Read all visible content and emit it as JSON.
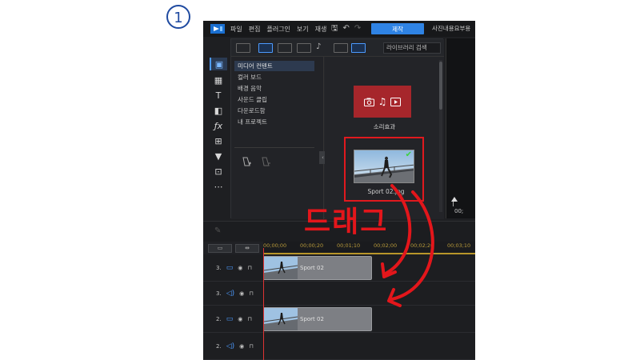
{
  "step_badge": {
    "number": "1"
  },
  "menubar": {
    "items": [
      "파일",
      "편집",
      "플러그인",
      "보기",
      "재생"
    ],
    "produce_label": "제작",
    "right_text": "사진내용요부용",
    "icons": [
      "save-icon",
      "undo-icon",
      "redo-icon"
    ]
  },
  "rail": {
    "items": [
      {
        "icon": "media-room-icon",
        "glyph": "▣"
      },
      {
        "icon": "film-icon",
        "glyph": "▦"
      },
      {
        "icon": "title-icon",
        "glyph": "T"
      },
      {
        "icon": "transition-icon",
        "glyph": "◧"
      },
      {
        "icon": "fx-icon",
        "glyph": "ƒx"
      },
      {
        "icon": "pip-icon",
        "glyph": "⊞"
      },
      {
        "icon": "particle-icon",
        "glyph": "▼"
      },
      {
        "icon": "chapter-icon",
        "glyph": "⊡"
      },
      {
        "icon": "more-icon",
        "glyph": "⋯"
      }
    ]
  },
  "library": {
    "search_placeholder": "라이브러리 검색",
    "tree": [
      "미디어 컨텐트",
      "컬러 보드",
      "배경 음악",
      "사운드 클립",
      "다운로드함",
      "내 프로젝트"
    ],
    "selected_index": 0,
    "tiles": [
      {
        "label": "소리효과"
      },
      {
        "label": "Sport 02.jpg"
      }
    ]
  },
  "timeline": {
    "ruler": [
      "00;00;00",
      "00;00;20",
      "00;01;10",
      "00;02;00",
      "00;02;20",
      "00;03;10"
    ],
    "tracks": [
      {
        "label": "3.",
        "type": "video",
        "clip": "Sport 02"
      },
      {
        "label": "3.",
        "type": "audio",
        "clip": ""
      },
      {
        "label": "2.",
        "type": "video",
        "clip": "Sport 02"
      },
      {
        "label": "2.",
        "type": "audio",
        "clip": ""
      }
    ]
  },
  "annotation": {
    "drag_text": "드래그",
    "accent_color": "#e3161b"
  }
}
